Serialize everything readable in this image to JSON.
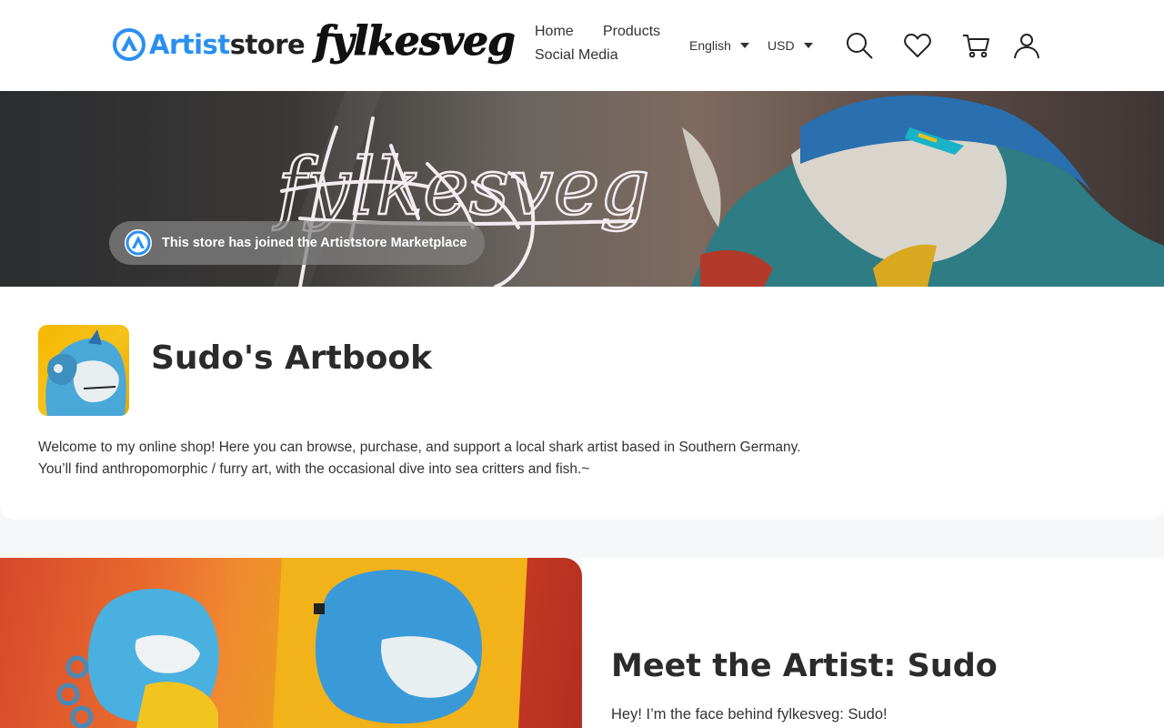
{
  "header": {
    "platform_logo": {
      "text_part1": "Artist",
      "text_part2": "store"
    },
    "shop_logo_text": "fylkesveg",
    "nav": {
      "home": "Home",
      "products": "Products",
      "social_media": "Social Media"
    },
    "language": "English",
    "currency": "USD",
    "icons": [
      "search-icon",
      "heart-icon",
      "cart-icon",
      "user-icon"
    ]
  },
  "banner": {
    "signature": "fylkesveg",
    "marketplace_notice": "This store has joined the Artiststore Marketplace"
  },
  "store": {
    "name": "Sudo's Artbook",
    "description_line1": "Welcome to my online shop! Here you can browse, purchase, and support a local shark artist based in Southern Germany.",
    "description_line2": "You’ll find anthropomorphic / furry art, with the occasional dive into sea critters and fish.~"
  },
  "meet": {
    "title": "Meet the Artist: Sudo",
    "intro": "Hey! I’m the face behind fylkesveg: Sudo!"
  },
  "colors": {
    "brand_blue": "#2a8ff0",
    "text_dark": "#2b2b2b",
    "page_bg": "#f6f7f9"
  }
}
